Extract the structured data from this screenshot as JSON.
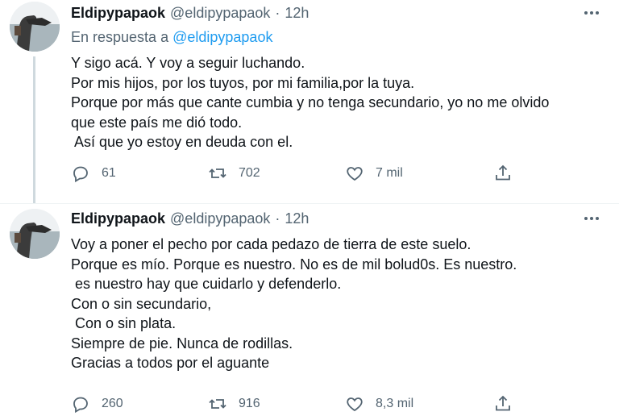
{
  "tweets": [
    {
      "name": "Eldipypapaok",
      "handle": "@eldipypapaok",
      "separator": "·",
      "time": "12h",
      "reply_prefix": "En respuesta a",
      "reply_mention": "@eldipypapaok",
      "body": "Y sigo acá. Y voy a seguir luchando.\nPor mis hijos, por los tuyos, por mi familia,por la tuya.\nPorque por más que cante cumbia y no tenga secundario, yo no me olvido\nque este país me dió todo.\n Así que yo estoy en deuda con el.",
      "replies": "61",
      "retweets": "702",
      "likes": "7 mil"
    },
    {
      "name": "Eldipypapaok",
      "handle": "@eldipypapaok",
      "separator": "·",
      "time": "12h",
      "body": "Voy a poner el pecho por cada pedazo de tierra de este suelo.\nPorque es mío. Porque es nuestro. No es de mil bolud0s. Es nuestro.\n es nuestro hay que cuidarlo y defenderlo.\nCon o sin secundario,\n Con o sin plata.\nSiempre de pie. Nunca de rodillas.\nGracias a todos por el aguante",
      "replies": "260",
      "retweets": "916",
      "likes": "8,3 mil"
    }
  ],
  "icons": {
    "reply": "reply-icon",
    "retweet": "retweet-icon",
    "like": "heart-icon",
    "share": "share-icon",
    "more": "more-icon"
  },
  "colors": {
    "text": "#0f1419",
    "secondary": "#536471",
    "link": "#1d9bf0",
    "thread_line": "#cfd9de"
  }
}
